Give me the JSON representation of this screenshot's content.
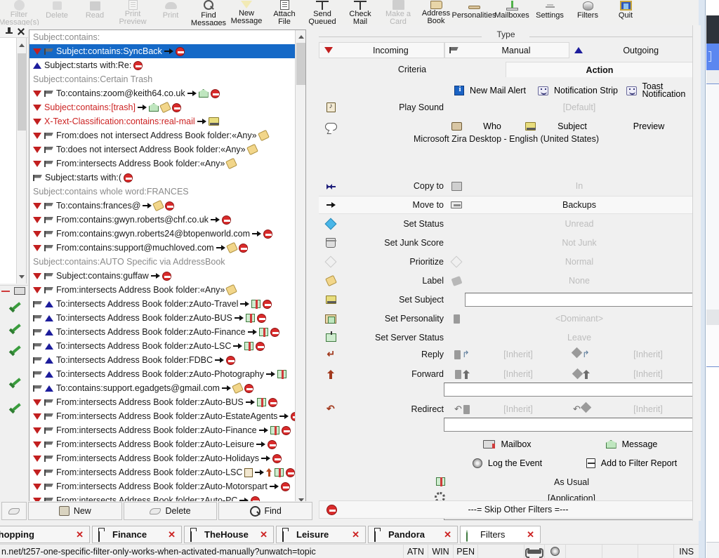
{
  "toolbar": {
    "items": [
      {
        "label1": "Filter",
        "label2": "Message(s)",
        "icon": "filter-messages-icon",
        "disabled": true
      },
      {
        "label1": "Delete",
        "label2": "",
        "icon": "delete-icon",
        "disabled": true
      },
      {
        "label1": "Read",
        "label2": "",
        "icon": "read-icon",
        "disabled": true
      },
      {
        "label1": "Print",
        "label2": "Preview",
        "icon": "print-preview-icon",
        "disabled": true
      },
      {
        "label1": "Print",
        "label2": "",
        "icon": "print-icon",
        "disabled": true
      },
      {
        "label1": "Find",
        "label2": "Messages",
        "icon": "find-messages-icon",
        "disabled": false
      },
      {
        "label1": "New",
        "label2": "Message",
        "icon": "new-message-icon",
        "disabled": false
      },
      {
        "label1": "Attach",
        "label2": "File",
        "icon": "attach-file-icon",
        "disabled": false
      },
      {
        "label1": "Send",
        "label2": "Queued",
        "icon": "send-queued-icon",
        "disabled": false
      },
      {
        "label1": "Check",
        "label2": "Mail",
        "icon": "check-mail-icon",
        "disabled": false
      },
      {
        "label1": "Make a",
        "label2": "Card",
        "icon": "make-a-card-icon",
        "disabled": true
      },
      {
        "label1": "Address",
        "label2": "Book",
        "icon": "address-book-icon",
        "disabled": false
      },
      {
        "label1": "Personalities",
        "label2": "",
        "icon": "personalities-icon",
        "disabled": false
      },
      {
        "label1": "Mailboxes",
        "label2": "",
        "icon": "mailboxes-icon",
        "disabled": false
      },
      {
        "label1": "Settings",
        "label2": "",
        "icon": "settings-icon",
        "disabled": false
      },
      {
        "label1": "Filters",
        "label2": "",
        "icon": "filters-icon",
        "disabled": false
      },
      {
        "label1": "Quit",
        "label2": "",
        "icon": "quit-icon",
        "disabled": false
      }
    ]
  },
  "filter_list": {
    "rows": [
      {
        "text": "Subject:contains:",
        "style": "group",
        "icons": []
      },
      {
        "text": "Subject:contains:SyncBack",
        "style": "selected",
        "icons": [
          "down",
          "flag"
        ],
        "trail": [
          "arrow",
          "stop"
        ]
      },
      {
        "text": "Subject:starts with:Re:",
        "style": "normal",
        "icons": [
          "up"
        ],
        "trail": [
          "stop"
        ]
      },
      {
        "text": "Subject:contains:Certain Trash",
        "style": "group",
        "icons": []
      },
      {
        "text": "To:contains:zoom@keith64.co.uk",
        "style": "normal",
        "icons": [
          "down",
          "flag"
        ],
        "trail": [
          "arrow",
          "home",
          "stop"
        ]
      },
      {
        "text": "Subject:contains:[trash]",
        "style": "red",
        "icons": [
          "down"
        ],
        "trail": [
          "arrow",
          "home",
          "tag",
          "stop"
        ]
      },
      {
        "text": "X-Text-Classification:contains:real-mail",
        "style": "red",
        "icons": [
          "down"
        ],
        "trail": [
          "arrow",
          "subject"
        ]
      },
      {
        "text": "From:does not intersect Address Book folder:«Any»",
        "style": "normal",
        "icons": [
          "down",
          "flag"
        ],
        "trail": [
          "tag"
        ]
      },
      {
        "text": "To:does not intersect Address Book folder:«Any»",
        "style": "normal",
        "icons": [
          "down",
          "flag"
        ],
        "trail": [
          "tag"
        ]
      },
      {
        "text": "From:intersects Address Book folder:«Any»",
        "style": "normal",
        "icons": [
          "down",
          "flag"
        ],
        "trail": [
          "tag"
        ]
      },
      {
        "text": "Subject:starts with:(",
        "style": "normal",
        "icons": [
          "flag"
        ],
        "trail": [
          "stop"
        ]
      },
      {
        "text": "Subject:contains whole word:FRANCES",
        "style": "group",
        "icons": []
      },
      {
        "text": "To:contains:frances@",
        "style": "normal",
        "icons": [
          "down",
          "flag"
        ],
        "trail": [
          "arrow",
          "tag",
          "stop"
        ]
      },
      {
        "text": "From:contains:gwyn.roberts@chf.co.uk",
        "style": "normal",
        "icons": [
          "down",
          "flag"
        ],
        "trail": [
          "arrow",
          "stop"
        ]
      },
      {
        "text": "From:contains:gwyn.roberts24@btopenworld.com",
        "style": "normal",
        "icons": [
          "down",
          "flag"
        ],
        "trail": [
          "arrow",
          "stop"
        ]
      },
      {
        "text": "From:contains:support@muchloved.com",
        "style": "normal",
        "icons": [
          "down",
          "flag"
        ],
        "trail": [
          "arrow",
          "tag",
          "stop"
        ]
      },
      {
        "text": "Subject:contains:AUTO Specific via AddressBook",
        "style": "group",
        "icons": []
      },
      {
        "text": "Subject:contains:guffaw",
        "style": "normal",
        "icons": [
          "down",
          "flag"
        ],
        "trail": [
          "arrow",
          "stop"
        ]
      },
      {
        "text": "From:intersects Address Book folder:«Any»",
        "style": "normal",
        "icons": [
          "down",
          "flag"
        ],
        "trail": [
          "tag"
        ]
      },
      {
        "text": "To:intersects Address Book folder:zAuto-Travel",
        "style": "normal",
        "icons": [
          "flag",
          "up"
        ],
        "trail": [
          "arrow",
          "gift",
          "stop"
        ]
      },
      {
        "text": "To:intersects Address Book folder:zAuto-BUS",
        "style": "normal",
        "icons": [
          "flag",
          "up"
        ],
        "trail": [
          "arrow",
          "gift",
          "stop"
        ]
      },
      {
        "text": "To:intersects Address Book folder:zAuto-Finance",
        "style": "normal",
        "icons": [
          "flag",
          "up"
        ],
        "trail": [
          "arrow",
          "gift",
          "stop"
        ]
      },
      {
        "text": "To:intersects Address Book folder:zAuto-LSC",
        "style": "normal",
        "icons": [
          "flag",
          "up"
        ],
        "trail": [
          "arrow",
          "gift",
          "stop"
        ]
      },
      {
        "text": "To:intersects Address Book folder:FDBC",
        "style": "normal",
        "icons": [
          "flag",
          "up"
        ],
        "trail": [
          "arrow",
          "stop"
        ]
      },
      {
        "text": "To:intersects Address Book folder:zAuto-Photography",
        "style": "normal",
        "icons": [
          "flag",
          "up"
        ],
        "trail": [
          "arrow",
          "gift"
        ]
      },
      {
        "text": "To:contains:support.egadgets@gmail.com",
        "style": "normal",
        "icons": [
          "flag",
          "up"
        ],
        "trail": [
          "arrow",
          "tag",
          "stop"
        ]
      },
      {
        "text": "From:intersects Address Book folder:zAuto-BUS",
        "style": "normal",
        "icons": [
          "down",
          "flag"
        ],
        "trail": [
          "arrow",
          "gift",
          "stop"
        ]
      },
      {
        "text": "From:intersects Address Book folder:zAuto-EstateAgents",
        "style": "normal",
        "icons": [
          "down",
          "flag"
        ],
        "trail": [
          "arrow",
          "stop"
        ]
      },
      {
        "text": "From:intersects Address Book folder:zAuto-Finance",
        "style": "normal",
        "icons": [
          "down",
          "flag"
        ],
        "trail": [
          "arrow",
          "gift",
          "stop"
        ]
      },
      {
        "text": "From:intersects Address Book folder:zAuto-Leisure",
        "style": "normal",
        "icons": [
          "down",
          "flag"
        ],
        "trail": [
          "arrow",
          "stop"
        ]
      },
      {
        "text": "From:intersects Address Book folder:zAuto-Holidays",
        "style": "normal",
        "icons": [
          "down",
          "flag"
        ],
        "trail": [
          "arrow",
          "stop"
        ]
      },
      {
        "text": "From:intersects Address Book folder:zAuto-LSC",
        "style": "normal",
        "icons": [
          "down",
          "flag"
        ],
        "trail": [
          "sound",
          "arrow",
          "uparrow",
          "gift",
          "stop"
        ]
      },
      {
        "text": "From:intersects Address Book folder:zAuto-Motorspart",
        "style": "normal",
        "icons": [
          "down",
          "flag"
        ],
        "trail": [
          "arrow",
          "stop"
        ]
      },
      {
        "text": "From:intersects Address Book folder:zAuto-PC",
        "style": "normal",
        "icons": [
          "down",
          "flag"
        ],
        "trail": [
          "arrow",
          "stop"
        ]
      }
    ]
  },
  "bottom_buttons": {
    "new_label": "New",
    "delete_label": "Delete",
    "find_label": "Find"
  },
  "settings": {
    "group_title": "Type",
    "type_options": [
      {
        "label": "Incoming",
        "icon": "down-triangle-icon",
        "selected": true
      },
      {
        "label": "Manual",
        "icon": "flag-icon",
        "selected": true
      },
      {
        "label": "Outgoing",
        "icon": "up-triangle-icon",
        "selected": false
      }
    ],
    "tabs": [
      {
        "label": "Criteria",
        "active": false
      },
      {
        "label": "Action",
        "active": true
      }
    ],
    "alerts": [
      {
        "label": "New Mail Alert",
        "icon": "info-icon"
      },
      {
        "label": "Notification Strip",
        "icon": "face-icon"
      },
      {
        "label": "Toast Notification",
        "icon": "face-icon"
      }
    ],
    "play_sound": {
      "label": "Play Sound",
      "value": "[Default]",
      "icon": "note-icon"
    },
    "speech": {
      "icon": "speech-bubble-icon",
      "who_icon": "who-icon",
      "who_label": "Who",
      "subject_icon": "subject-icon",
      "subject_label": "Subject",
      "preview_label": "Preview",
      "voice": "Microsoft Zira Desktop - English (United States)"
    },
    "rows": [
      {
        "label": "Copy to",
        "value": "In",
        "icon": "copy-to-icon",
        "icon2": "folder-icon",
        "enabled": false,
        "highlight": false
      },
      {
        "label": "Move to",
        "value": "Backups",
        "icon": "move-to-icon",
        "icon2": "tray-icon",
        "enabled": true,
        "highlight": true
      },
      {
        "label": "Set Status",
        "value": "Unread",
        "icon": "status-diamond-icon",
        "icon2": "",
        "enabled": false,
        "highlight": false
      },
      {
        "label": "Set Junk Score",
        "value": "Not Junk",
        "icon": "junk-icon",
        "icon2": "",
        "enabled": false,
        "highlight": false
      },
      {
        "label": "Prioritize",
        "value": "Normal",
        "icon": "prioritize-icon",
        "icon2": "diamond-outline-icon",
        "enabled": false,
        "highlight": false
      },
      {
        "label": "Label",
        "value": "None",
        "icon": "label-tag-icon",
        "icon2": "label-gray-icon",
        "enabled": false,
        "highlight": false
      },
      {
        "label": "Set Subject",
        "value": "",
        "icon": "subject-icon",
        "icon2": "",
        "enabled": true,
        "highlight": false
      },
      {
        "label": "Set Personality",
        "value": "<Dominant>",
        "icon": "personality-icon",
        "icon2": "gray-square-icon",
        "enabled": false,
        "highlight": false
      },
      {
        "label": "Set Server Status",
        "value": "Leave",
        "icon": "server-icon",
        "icon2": "",
        "enabled": false,
        "highlight": false
      }
    ],
    "reply": {
      "label": "Reply",
      "icon": "reply-icon",
      "left_value": "[Inherit]",
      "right_value": "[Inherit]"
    },
    "forward": {
      "label": "Forward",
      "icon": "forward-icon",
      "left_value": "[Inherit]",
      "right_value": "[Inherit]",
      "field_value": ""
    },
    "redirect": {
      "label": "Redirect",
      "icon": "redirect-icon",
      "left_value": "[Inherit]",
      "right_value": "[Inherit]",
      "field_value": ""
    },
    "extras": [
      {
        "left_label": "Mailbox",
        "left_icon": "mailbox-icon",
        "right_label": "Message",
        "right_icon": "message-icon"
      },
      {
        "left_label": "Log the Event",
        "left_icon": "log-icon",
        "right_label": "Add to Filter Report",
        "right_icon": "report-icon"
      }
    ],
    "as_usual": {
      "label": "As Usual",
      "icon": "gift-icon"
    },
    "application": {
      "label": "[Application]",
      "icon": "gear-icon",
      "field_value": ""
    },
    "skip": {
      "label": "---= Skip Other Filters =---",
      "icon": "stop-icon"
    }
  },
  "tabs": {
    "items": [
      {
        "label": "Shopping",
        "icon": "folder-icon",
        "current": false
      },
      {
        "label": "Finance",
        "icon": "folder-icon",
        "current": false
      },
      {
        "label": "TheHouse",
        "icon": "folder-icon",
        "current": false
      },
      {
        "label": "Leisure",
        "icon": "folder-icon",
        "current": false
      },
      {
        "label": "Pandora",
        "icon": "folder-icon",
        "current": false
      },
      {
        "label": "Filters",
        "icon": "message-icon",
        "current": true
      }
    ],
    "close_glyph": "✕"
  },
  "statusbar": {
    "url": "n.net/t257-one-specific-filter-only-works-when-activated-manually?unwatch=topic",
    "cells": [
      "ATN",
      "WIN",
      "PEN"
    ],
    "insert_mode": "INS"
  }
}
